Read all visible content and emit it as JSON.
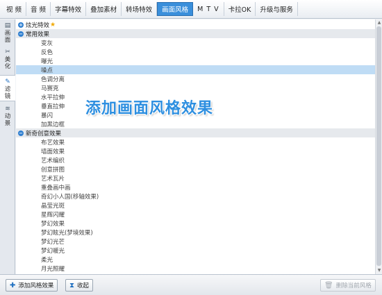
{
  "topbar": {
    "tabs": [
      {
        "label": "视 频"
      },
      {
        "label": "音 频"
      },
      {
        "label": "字幕特效"
      },
      {
        "label": "叠加素材"
      },
      {
        "label": "转场特效"
      },
      {
        "label": "画面风格"
      },
      {
        "label": "MTV"
      },
      {
        "label": "卡拉OK"
      },
      {
        "label": "升级与服务"
      }
    ],
    "active_tab": "画面风格"
  },
  "sidebar": {
    "items": [
      {
        "icon": "picture-icon",
        "chars": [
          "画",
          "面"
        ]
      },
      {
        "icon": "beautify-icon",
        "chars": [
          "美",
          "化"
        ]
      },
      {
        "icon": "filter-icon",
        "chars": [
          "滤",
          "镜"
        ]
      },
      {
        "icon": "animation-icon",
        "chars": [
          "动",
          "景"
        ]
      }
    ],
    "active": "滤镜"
  },
  "list": {
    "favorite": {
      "label": "炫光特效"
    },
    "groups": [
      {
        "label": "常用效果",
        "items": [
          "变灰",
          "反色",
          "曝光",
          "噪点",
          "色调分离",
          "马赛克",
          "水平拉伸",
          "垂直拉伸",
          "暴闪",
          "加黑边框"
        ]
      },
      {
        "label": "新奇创意效果",
        "items": [
          "布艺效果",
          "墙面效果",
          "艺术编织",
          "创意拼图",
          "艺术瓦片",
          "重叠画中画",
          "奇幻小人国(移轴效果)",
          "晶莹光斑",
          "星辉闪耀",
          "梦幻效果",
          "梦幻眩光(梦境效果)",
          "梦幻光芒",
          "梦幻暖光",
          "柔光",
          "月光照耀"
        ]
      }
    ],
    "selected_item": "噪点"
  },
  "overlay": {
    "text": "添加画面风格效果"
  },
  "bottombar": {
    "add_button": "添加风格效果",
    "favorite_button": "收起",
    "delete_button": "删除当前风格"
  },
  "colors": {
    "accent": "#3a8fdb",
    "selected_row": "#bfdcf5",
    "overlay_text": "#2e8fe0"
  }
}
